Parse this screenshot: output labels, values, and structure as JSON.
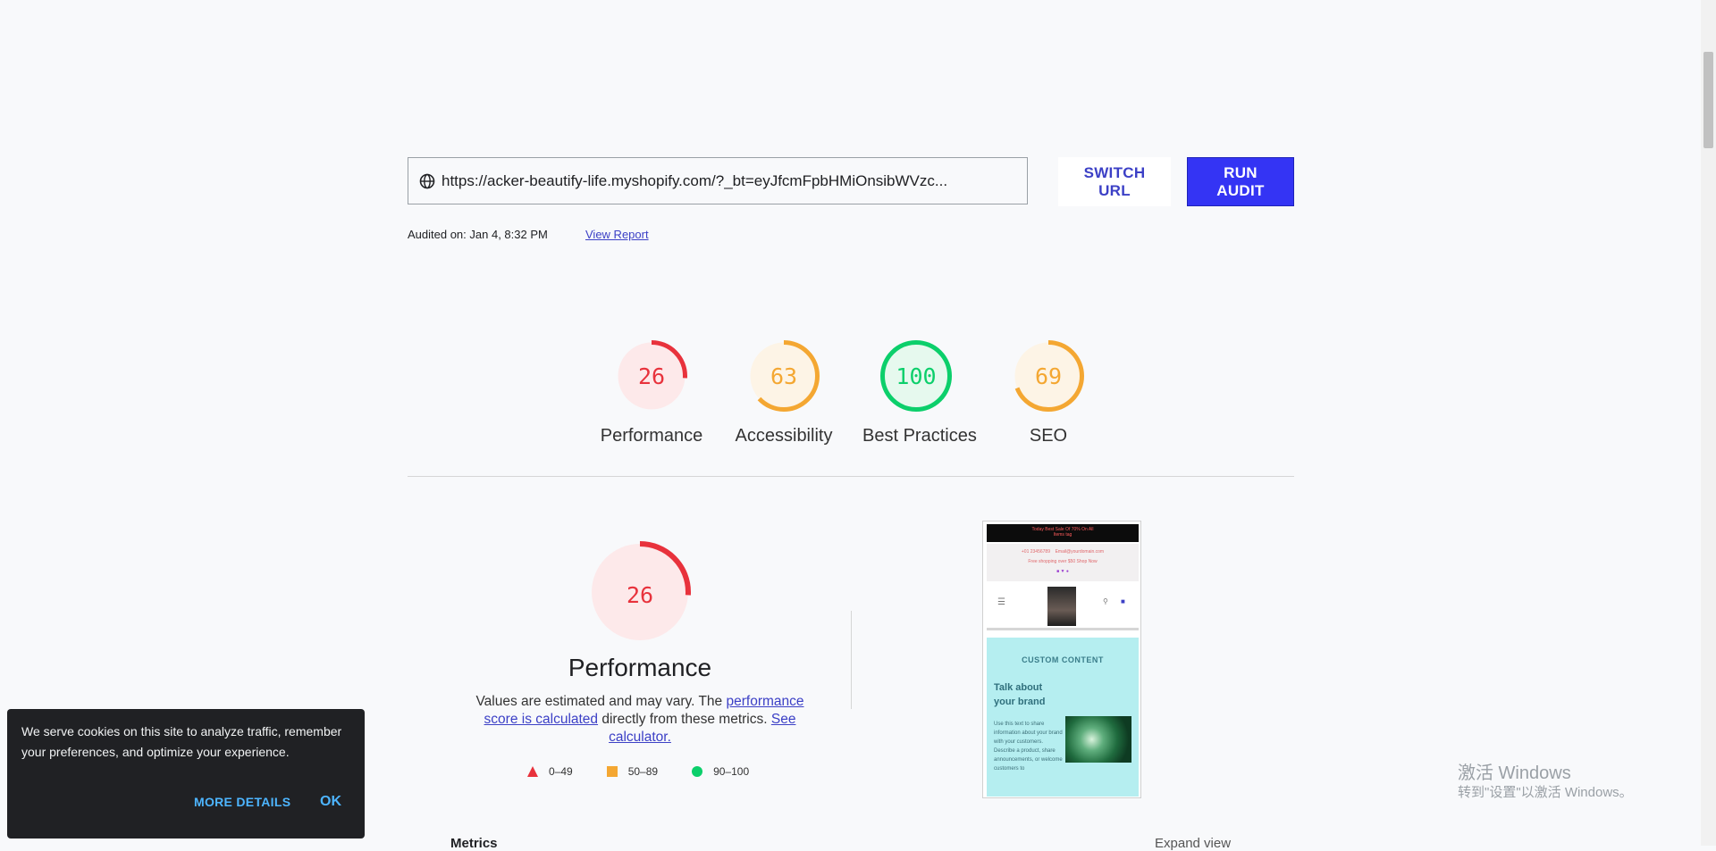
{
  "url_bar": {
    "url": "https://acker-beautify-life.myshopify.com/?_bt=eyJfcmFpbHMiOnsibWVzc..."
  },
  "buttons": {
    "switch_line1": "SWITCH",
    "switch_line2": "URL",
    "run_line1": "RUN",
    "run_line2": "AUDIT"
  },
  "audit": {
    "audited_on": "Audited on: Jan 4, 8:32 PM",
    "view_report": "View Report"
  },
  "gauges": [
    {
      "score": 26,
      "label": "Performance",
      "color": "#e8323c"
    },
    {
      "score": 63,
      "label": "Accessibility",
      "color": "#f4a732"
    },
    {
      "score": 100,
      "label": "Best Practices",
      "color": "#0ccf6b"
    },
    {
      "score": 69,
      "label": "SEO",
      "color": "#f4a732"
    }
  ],
  "performance": {
    "score": 26,
    "title": "Performance",
    "desc_1": "Values are estimated and may vary. The ",
    "desc_link1": "performance score is calculated",
    "desc_2": " directly from these metrics. ",
    "desc_link2": "See calculator.",
    "legend": [
      {
        "range": "0–49",
        "color": "#e8323c",
        "shape": "triangle"
      },
      {
        "range": "50–89",
        "color": "#f4a732",
        "shape": "square"
      },
      {
        "range": "90–100",
        "color": "#0ccf6b",
        "shape": "circle"
      }
    ]
  },
  "phone": {
    "promo": "Today Best Sale Of 70% On All",
    "promo2": "Items tag",
    "phone_num": "+01 23456789",
    "email": "Email@yourdomain.com",
    "shipping": "Free shopping over $50 Shop Now",
    "custom_title": "CUSTOM CONTENT",
    "heading1": "Talk about",
    "heading2": "your brand",
    "para": "Use this text to share information about your brand with your customers. Describe a product, share announcements, or welcome customers to"
  },
  "cookie": {
    "text": "We serve cookies on this site to analyze traffic, remember your preferences, and optimize your experience.",
    "more_details": "MORE DETAILS",
    "ok": "OK"
  },
  "sections": {
    "metrics": "Metrics",
    "expand_view": "Expand view"
  },
  "watermark": {
    "line1": "激活 Windows",
    "line2": "转到\"设置\"以激活 Windows。"
  }
}
